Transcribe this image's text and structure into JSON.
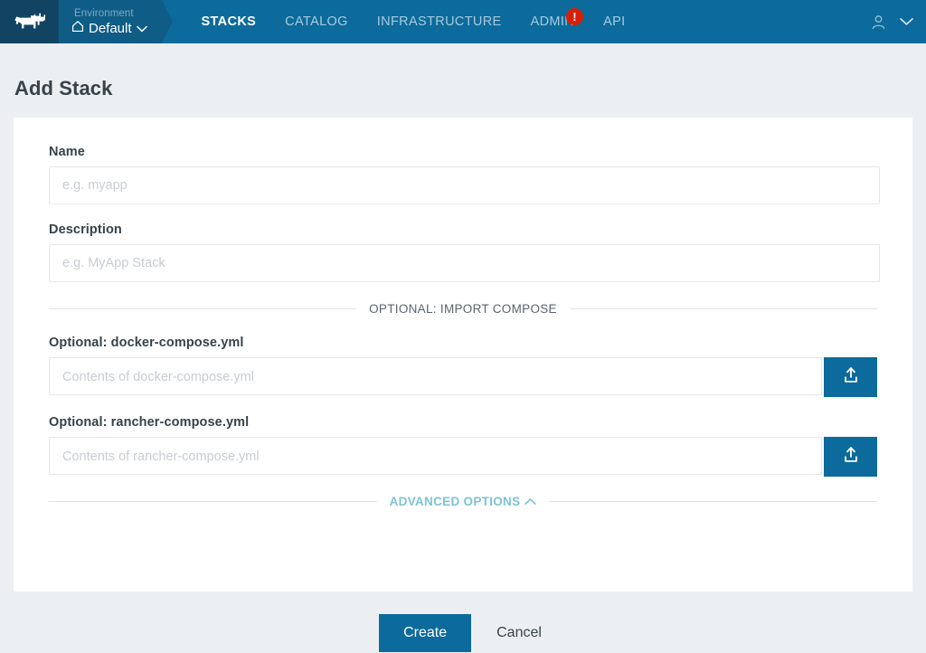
{
  "header": {
    "logo_icon": "cow-logo-icon",
    "environment": {
      "label": "Environment",
      "value": "Default",
      "home_icon": "home-icon",
      "chevron_icon": "chevron-down-icon"
    },
    "nav": [
      {
        "label": "STACKS",
        "active": true
      },
      {
        "label": "CATALOG",
        "active": false
      },
      {
        "label": "INFRASTRUCTURE",
        "active": false
      },
      {
        "label": "ADMIN",
        "active": false,
        "badge": "!"
      },
      {
        "label": "API",
        "active": false
      }
    ],
    "user_icon": "user-icon",
    "user_chevron_icon": "chevron-down-icon"
  },
  "page": {
    "title": "Add Stack"
  },
  "form": {
    "name": {
      "label": "Name",
      "placeholder": "e.g. myapp",
      "value": ""
    },
    "description": {
      "label": "Description",
      "placeholder": "e.g. MyApp Stack",
      "value": ""
    },
    "import_divider": "OPTIONAL: IMPORT COMPOSE",
    "docker_compose": {
      "label": "Optional: docker-compose.yml",
      "placeholder": "Contents of docker-compose.yml",
      "value": "",
      "upload_icon": "upload-icon"
    },
    "rancher_compose": {
      "label": "Optional: rancher-compose.yml",
      "placeholder": "Contents of rancher-compose.yml",
      "value": "",
      "upload_icon": "upload-icon"
    },
    "advanced_options": {
      "label": "ADVANCED OPTIONS",
      "chevron_icon": "chevron-up-icon"
    }
  },
  "actions": {
    "create_label": "Create",
    "cancel_label": "Cancel"
  },
  "colors": {
    "header_blue": "#0c6b9c",
    "logo_navy": "#114463",
    "env_blue": "#0f5d86",
    "page_bg": "#eceff1",
    "text_dark": "#37424a",
    "accent_teal": "#7dc3d6",
    "alert_red": "#d81e06"
  }
}
